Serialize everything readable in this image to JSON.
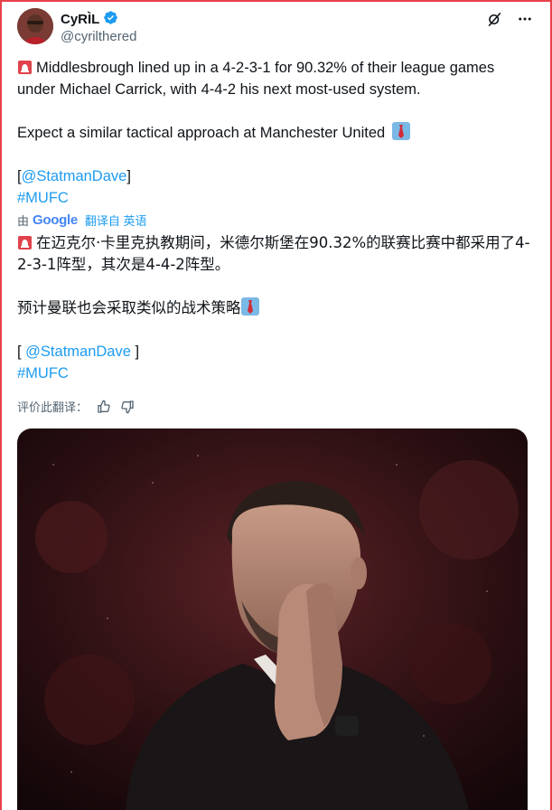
{
  "author": {
    "display_name": "CyRÌL",
    "handle": "@cyrilthered"
  },
  "post": {
    "line1": "Middlesbrough lined up in a 4-2-3-1 for 90.32% of their league games under Michael Carrick, with 4-4-2 his next most-used system.",
    "line2": "Expect a similar tactical approach at Manchester United",
    "bracket_open": "[",
    "mention": "@StatmanDave",
    "bracket_close": "]",
    "hashtag": "#MUFC"
  },
  "translation": {
    "by": "由",
    "google": "Google",
    "label": "翻译自 英语",
    "line1": "在迈克尔·卡里克执教期间，米德尔斯堡在90.32%的联赛比赛中都采用了4-2-3-1阵型，其次是4-4-2阵型。",
    "line2": "预计曼联也会采取类似的战术策略",
    "bracket_open": "[ ",
    "mention": "@StatmanDave",
    "bracket_close": " ]",
    "hashtag": "#MUFC",
    "rate_label": "评价此翻译："
  },
  "icons": {
    "verified": "verified-badge-icon",
    "grok": "grok-icon",
    "more": "more-icon",
    "siren": "siren-emoji-icon",
    "tie": "necktie-emoji-icon",
    "thumbs_up": "thumbs-up-icon",
    "thumbs_down": "thumbs-down-icon"
  },
  "colors": {
    "accent": "#1d9bf0",
    "secondary_text": "#536471",
    "frame_border": "#e8404a"
  }
}
